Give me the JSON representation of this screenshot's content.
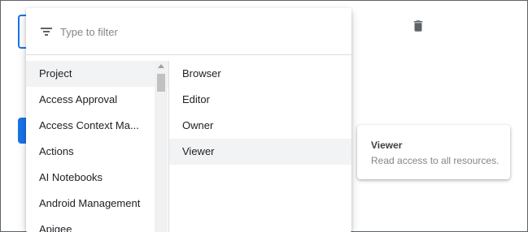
{
  "filter": {
    "placeholder": "Type to filter",
    "icon": "filter-list-icon"
  },
  "services": [
    {
      "label": "Project",
      "selected": true
    },
    {
      "label": "Access Approval",
      "selected": false
    },
    {
      "label": "Access Context Ma...",
      "selected": false
    },
    {
      "label": "Actions",
      "selected": false
    },
    {
      "label": "AI Notebooks",
      "selected": false
    },
    {
      "label": "Android Management",
      "selected": false
    },
    {
      "label": "Apigee",
      "selected": false
    }
  ],
  "roles": [
    {
      "label": "Browser",
      "highlighted": false
    },
    {
      "label": "Editor",
      "highlighted": false
    },
    {
      "label": "Owner",
      "highlighted": false
    },
    {
      "label": "Viewer",
      "highlighted": true
    }
  ],
  "tooltip": {
    "title": "Viewer",
    "description": "Read access to all resources."
  },
  "background": {
    "delete_icon": "trash-icon"
  },
  "colors": {
    "accent": "#1a73e8",
    "selected_row": "#f1f3f4",
    "divider": "#dadce0"
  }
}
